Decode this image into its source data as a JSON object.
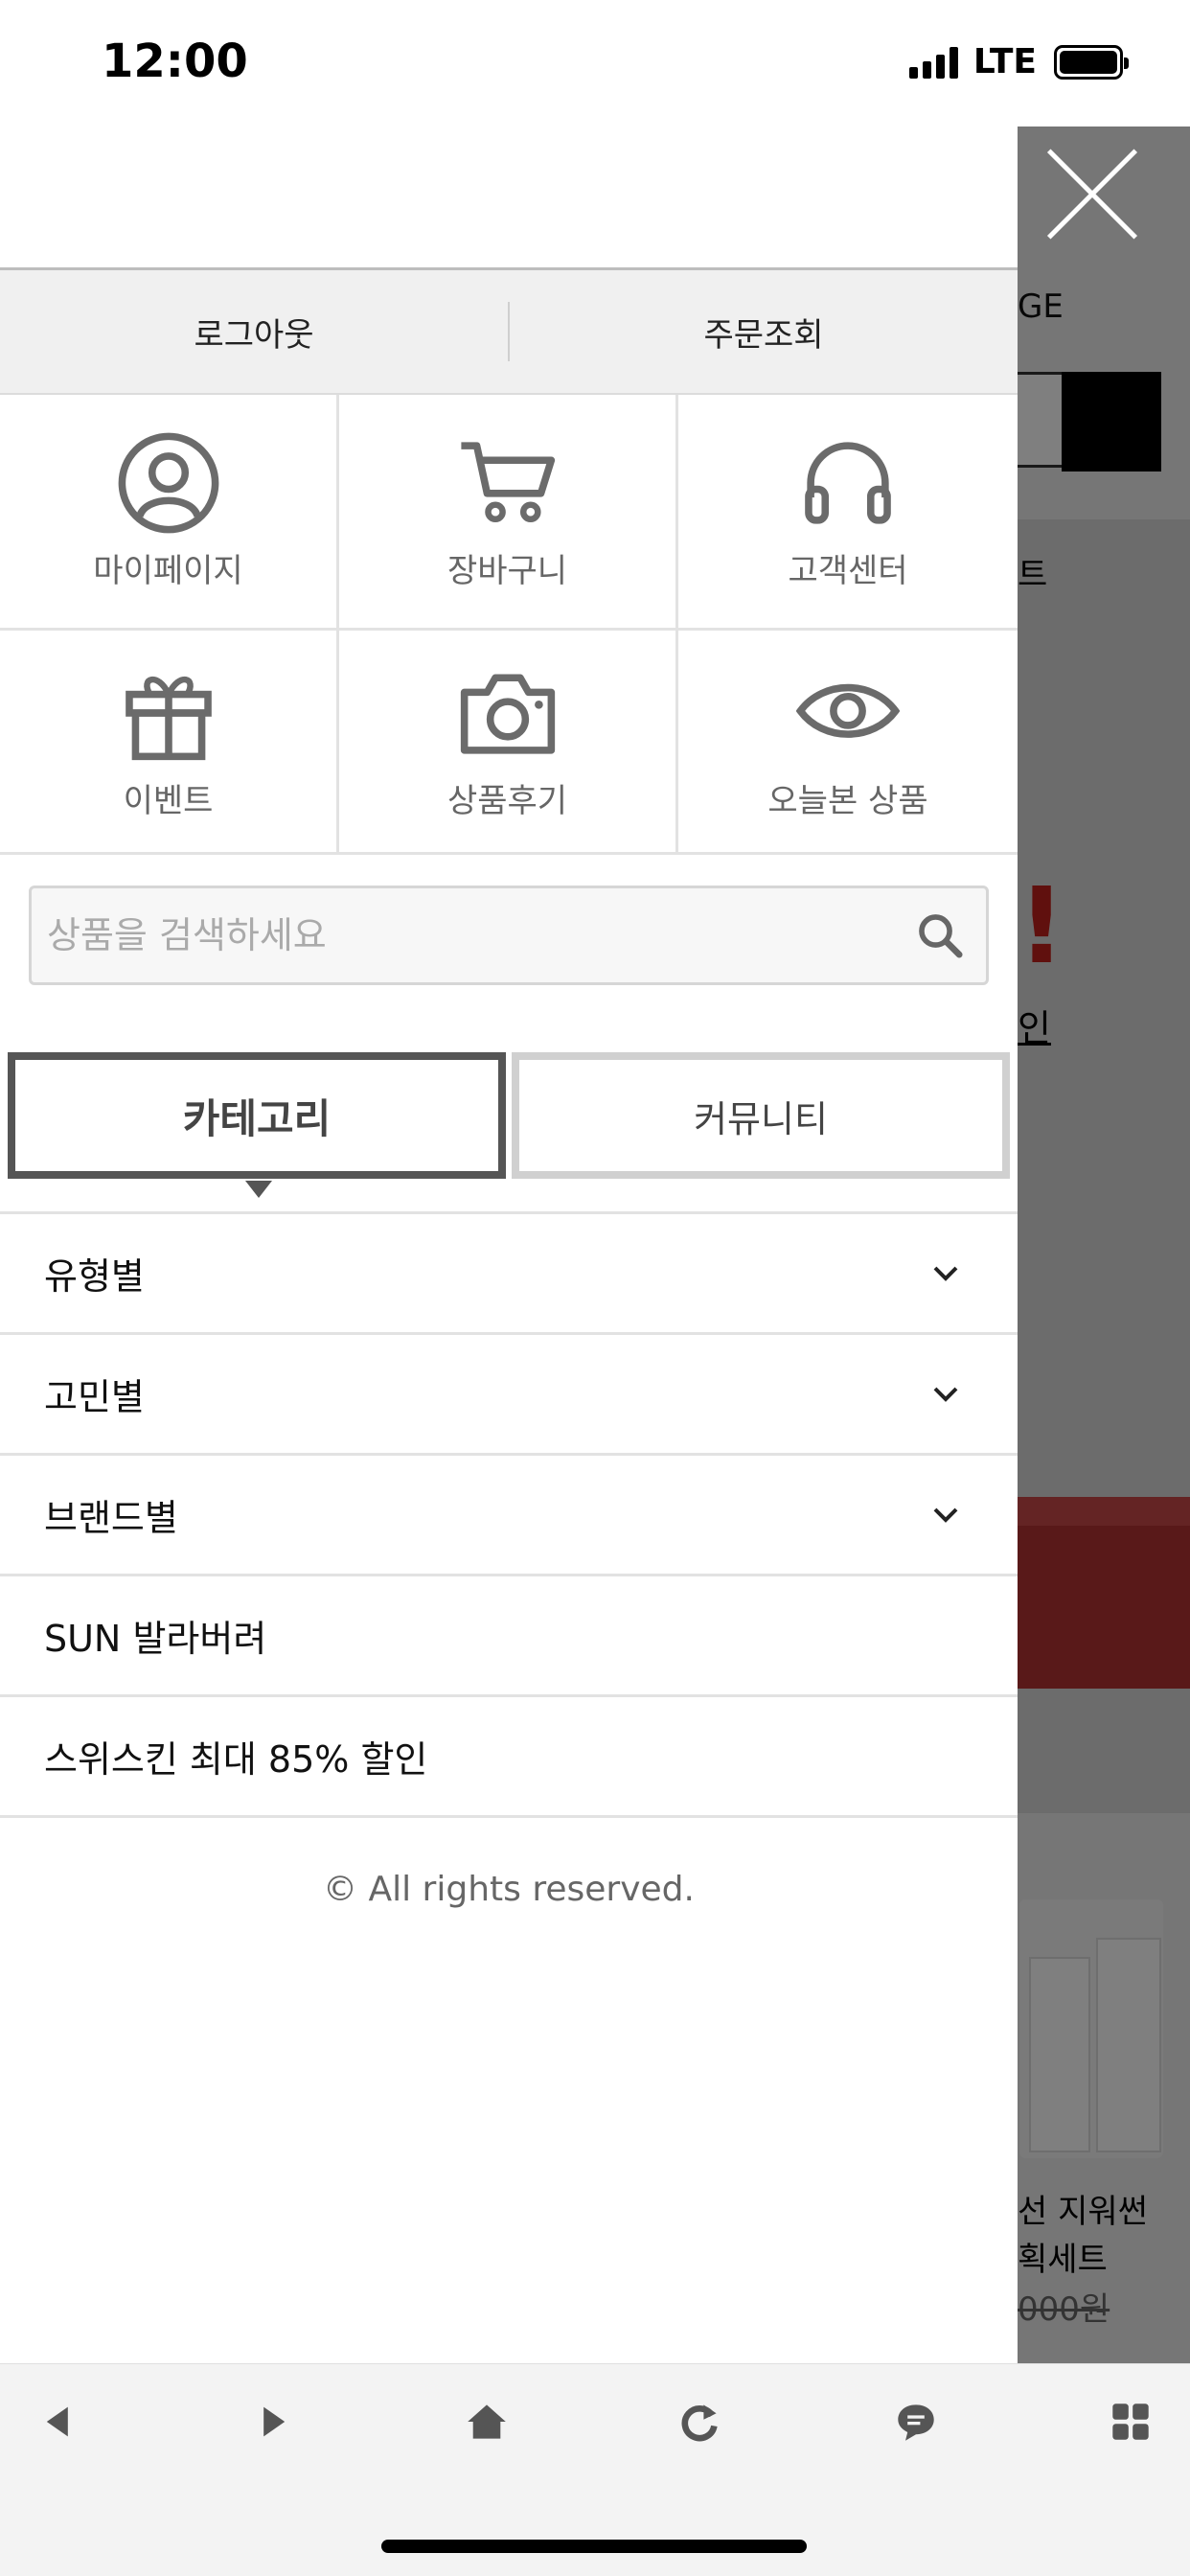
{
  "status_bar": {
    "time": "12:00",
    "network": "LTE"
  },
  "background_page": {
    "partial_text_1": "GE",
    "partial_text_2": "트",
    "partial_text_3": "!",
    "partial_text_4": "인",
    "partial_text_5": "선 지워썬",
    "partial_text_6": "획세트",
    "partial_text_7": "000원"
  },
  "drawer": {
    "account": {
      "logout": "로그아웃",
      "order_lookup": "주문조회"
    },
    "shortcuts_row1": [
      {
        "label": "마이페이지",
        "icon": "user-circle-icon"
      },
      {
        "label": "장바구니",
        "icon": "cart-icon"
      },
      {
        "label": "고객센터",
        "icon": "headset-icon"
      }
    ],
    "shortcuts_row2": [
      {
        "label": "이벤트",
        "icon": "gift-icon"
      },
      {
        "label": "상품후기",
        "icon": "camera-icon"
      },
      {
        "label": "오늘본 상품",
        "icon": "eye-icon"
      }
    ],
    "search": {
      "placeholder": "상품을 검색하세요"
    },
    "tabs": {
      "category": "카테고리",
      "community": "커뮤니티"
    },
    "categories": [
      {
        "label": "유형별",
        "expandable": true
      },
      {
        "label": "고민별",
        "expandable": true
      },
      {
        "label": "브랜드별",
        "expandable": true
      },
      {
        "label": "SUN 발라버려",
        "expandable": false
      },
      {
        "label": "스위스킨 최대 85% 할인",
        "expandable": false
      }
    ],
    "copyright": "© All rights reserved."
  },
  "colors": {
    "active_tab_border": "#555555",
    "inactive_tab_border": "#d0d0d0",
    "icon_gray": "#6b6b6b"
  }
}
